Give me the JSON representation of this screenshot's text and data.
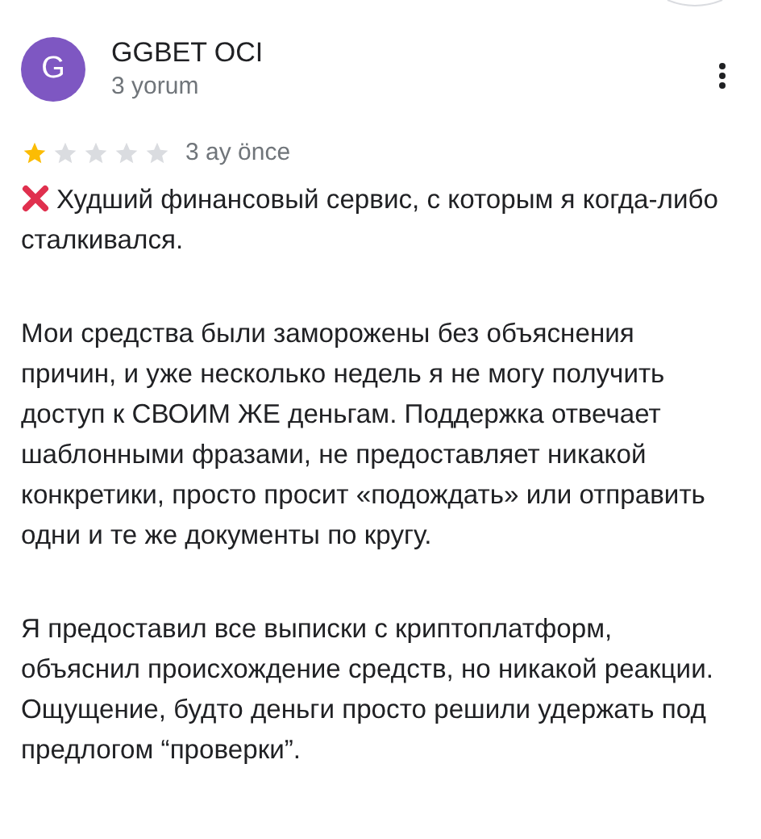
{
  "reviewer": {
    "initial": "G",
    "name": "GGBET OCI",
    "review_count": "3 yorum"
  },
  "review": {
    "stars": 1,
    "time": "3 ay önce",
    "negative_mark": true,
    "paragraphs": [
      [
        "Худший финансовый сервис, с которым я когда-либо сталкивался."
      ],
      [
        "Мои средства были заморожены без объяснения причин, и уже несколько недель я не могу получить доступ к СВОИМ ЖЕ деньгам. Поддержка отвечает шаблонными фразами, не предоставляет никакой конкретики, просто просит «подождать» или отправить одни и те же документы по кругу."
      ],
      [
        "Я предоставил все выписки с криптоплатформ, объяснил происхождение средств, но никакой реакции.",
        "Ощущение, будто деньги просто решили удержать под предлогом “проверки”."
      ]
    ]
  }
}
